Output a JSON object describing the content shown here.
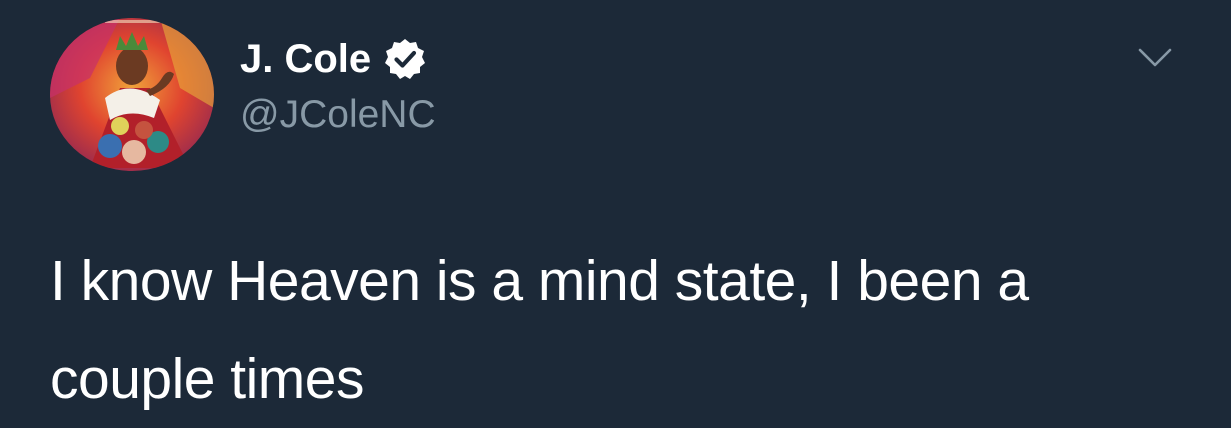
{
  "tweet": {
    "display_name": "J. Cole",
    "handle": "@JColeNC",
    "text": "I know Heaven is a mind state, I been a couple times",
    "verified": true
  },
  "icons": {
    "verified": "verified-badge-icon",
    "menu": "chevron-down-icon"
  },
  "colors": {
    "background": "#1c2938",
    "name": "#ffffff",
    "handle": "#8899a6",
    "text": "#ffffff"
  }
}
